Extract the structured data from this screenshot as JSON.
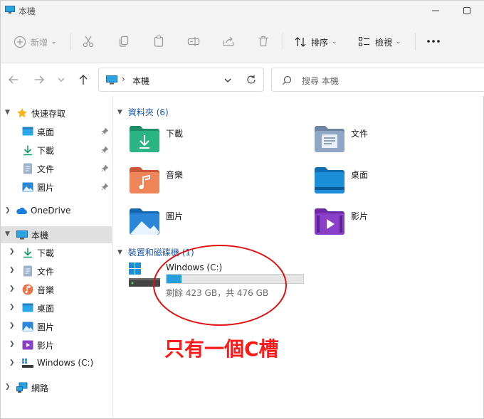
{
  "window": {
    "title": "本機"
  },
  "commands": {
    "new_label": "新增",
    "sort_label": "排序",
    "view_label": "檢視",
    "more_icon": "ellipsis-icon"
  },
  "address": {
    "location": "本機"
  },
  "search": {
    "placeholder": "搜尋 本機"
  },
  "sidebar": {
    "quick_access": "快速存取",
    "qa_items": [
      "桌面",
      "下載",
      "文件",
      "圖片"
    ],
    "onedrive": "OneDrive",
    "this_pc": "本機",
    "pc_items": [
      "下載",
      "文件",
      "音樂",
      "桌面",
      "圖片",
      "影片",
      "Windows (C:)"
    ],
    "network": "網路"
  },
  "content": {
    "folders_header": "資料夾 (6)",
    "folders": [
      {
        "name": "下載",
        "color": "#1fa67a"
      },
      {
        "name": "文件",
        "color": "#8fa7c4"
      },
      {
        "name": "音樂",
        "color": "#e8784a"
      },
      {
        "name": "桌面",
        "color": "#1a8ed8"
      },
      {
        "name": "圖片",
        "color": "#2a86d6"
      },
      {
        "name": "影片",
        "color": "#8a3fc8"
      }
    ],
    "devices_header": "裝置和磁碟機 (1)",
    "drive": {
      "name": "Windows (C:)",
      "free_text": "剩餘 423 GB，共 476 GB",
      "used_fraction": 0.11,
      "bar_color": "#26a0da"
    }
  },
  "annotation": {
    "text": "只有一個C槽",
    "color": "#ff1a1a"
  }
}
